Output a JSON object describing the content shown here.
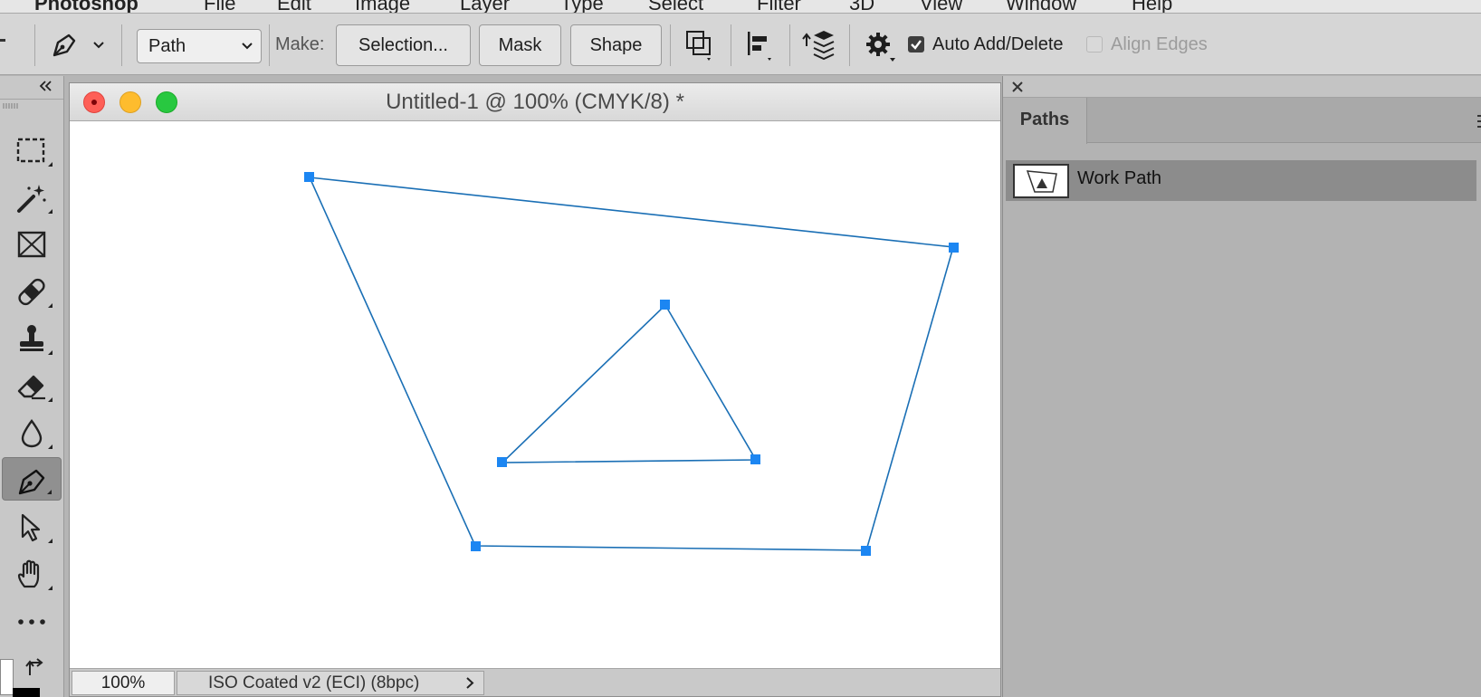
{
  "menubar": {
    "app_name": "Photoshop",
    "items": [
      "File",
      "Edit",
      "Image",
      "Layer",
      "Type",
      "Select",
      "Filter",
      "3D",
      "View",
      "Window",
      "Help"
    ]
  },
  "options_bar": {
    "tool_mode": "Path",
    "make_label": "Make:",
    "selection_button": "Selection...",
    "mask_button": "Mask",
    "shape_button": "Shape",
    "auto_add_delete": {
      "label": "Auto Add/Delete",
      "checked": true
    },
    "align_edges": {
      "label": "Align Edges",
      "checked": false
    }
  },
  "toolbox": {
    "tools": [
      {
        "name": "rectangular-marquee-icon"
      },
      {
        "name": "magic-wand-icon"
      },
      {
        "name": "frame-icon"
      },
      {
        "name": "healing-brush-icon"
      },
      {
        "name": "clone-stamp-icon"
      },
      {
        "name": "eraser-icon"
      },
      {
        "name": "blur-icon"
      },
      {
        "name": "pen-icon",
        "active": true
      },
      {
        "name": "path-selection-icon"
      },
      {
        "name": "hand-icon"
      },
      {
        "name": "more-tools-icon"
      }
    ]
  },
  "document": {
    "title": "Untitled-1 @ 100% (CMYK/8) *",
    "zoom": "100%",
    "color_profile": "ISO Coated v2 (ECI) (8bpc)",
    "path_stroke_color": "#1a6fb5",
    "anchor_color": "#1c86f2"
  },
  "paths_panel": {
    "tab_label": "Paths",
    "items": [
      {
        "name": "Work Path",
        "selected": true
      }
    ]
  }
}
